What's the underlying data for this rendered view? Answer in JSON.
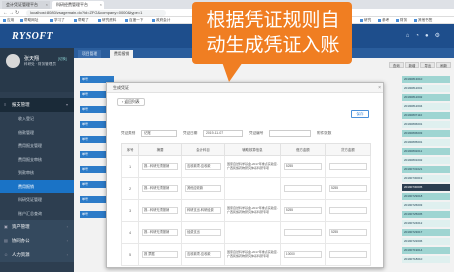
{
  "browser": {
    "tabs": [
      {
        "label": "会计凭证管理平台"
      },
      {
        "label": "科研经费管理平台"
      }
    ],
    "url": "localhost:8080/zsagemain.do?id=ZFG&company=0000&type=1",
    "bookmarks": [
      "应用",
      "帮助网址",
      "学习了",
      "帮助了",
      "研究资料",
      "百度一下",
      "政府会计",
      "研究",
      "参考",
      "财务",
      "其他书签"
    ]
  },
  "header": {
    "logo": "RYSOFT",
    "icons": [
      "home-icon",
      "bell-icon",
      "user-icon",
      "settings-icon"
    ]
  },
  "sidebar": {
    "user_name": "张天翔",
    "user_tag": "[切换]",
    "user_role": "科研处 · 财务管理员",
    "menu": [
      {
        "label": "报支管理",
        "type": "group",
        "open": true
      },
      {
        "label": "收入登记",
        "type": "item"
      },
      {
        "label": "借款管理",
        "type": "item"
      },
      {
        "label": "费用报支管理",
        "type": "item"
      },
      {
        "label": "费用报支审核",
        "type": "item"
      },
      {
        "label": "到款审核",
        "type": "item"
      },
      {
        "label": "费用报销",
        "type": "item",
        "active": true
      },
      {
        "label": "科研凭证管理",
        "type": "item"
      },
      {
        "label": "账户汇总查询",
        "type": "item"
      },
      {
        "label": "资产管理",
        "type": "group"
      },
      {
        "label": "协同办公",
        "type": "group"
      },
      {
        "label": "人力资源",
        "type": "group"
      }
    ]
  },
  "content": {
    "tabs": [
      "项目管理",
      "费用报销"
    ],
    "toolbar": [
      "查询",
      "新增",
      "导出",
      "刷新"
    ],
    "left_cells": [
      "单号",
      "单号",
      "单号",
      "单号",
      "单号",
      "单号",
      "单号",
      "单号",
      "单号",
      "单号"
    ],
    "right_cells": [
      "20190813010",
      "20190812001",
      "20190812002",
      "20190812004",
      "20190807110",
      "20190806001",
      "20190806003",
      "20190805001",
      "20190802011",
      "20190801002",
      "20190731021",
      "20190730019",
      "20190730005",
      "20190729018",
      "20190726003",
      "20190725005",
      "20190724012",
      "20190723017",
      "20190722006",
      "20190719014",
      "20190718010"
    ]
  },
  "modal": {
    "title": "生成凭证",
    "back_label": "返回列表",
    "save_label": "保存",
    "form": {
      "type_label": "凭证类别",
      "type_value": "记账",
      "date_label": "凭证日期",
      "date_value": "2019-11-07",
      "no_label": "凭证编号",
      "no_placeholder": "",
      "attach_label": "附件张数"
    },
    "columns": [
      "序号",
      "摘要",
      "会计科目",
      "辅助核算信息",
      "借方金额",
      "贷方金额"
    ],
    "rows": [
      {
        "no": "1",
        "summary": "报...科研无须报销",
        "account": "应收款项-应收款",
        "aux": "国家自然科学基金-2017年重点实验室-广西民族药物研究体系科研专项",
        "debit": "5255",
        "credit": ""
      },
      {
        "no": "2",
        "summary": "报...科研无须报销",
        "account": "其他应收款",
        "aux": "",
        "debit": "",
        "credit": "5255"
      },
      {
        "no": "3",
        "summary": "报...科研无须报销",
        "account": "科研支出-科研经费",
        "aux": "国家自然科学基金-2017年重点实验室-广西民族药物研究体系科研专项",
        "debit": "5255",
        "credit": ""
      },
      {
        "no": "4",
        "summary": "报...科研无须报销",
        "account": "经费支出",
        "aux": "",
        "debit": "",
        "credit": "5255"
      },
      {
        "no": "5",
        "summary": "报 票据",
        "account": "应收款项-应收款",
        "aux": "国家自然科学基金-2017年重点实验室-广西民族药物研究体系科研专项",
        "debit": "10000",
        "credit": ""
      }
    ]
  },
  "callout": {
    "text": "根据凭证规则自动生成凭证入账"
  },
  "colors": {
    "header": "#1e4e8c",
    "sidebar": "#2d3e50",
    "active_menu": "#1a73c6",
    "callout": "#f07e22",
    "teal": "#9fd5d2"
  }
}
